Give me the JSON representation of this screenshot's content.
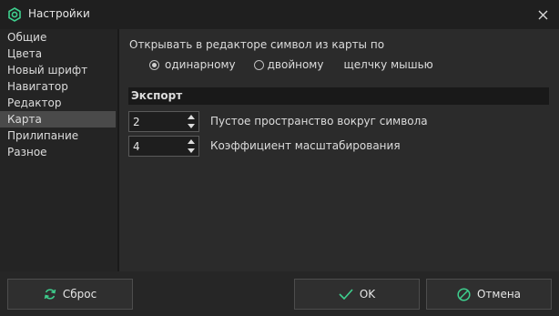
{
  "window": {
    "title": "Настройки",
    "accent": "#3ecf8e"
  },
  "sidebar": {
    "items": [
      {
        "label": "Общие"
      },
      {
        "label": "Цвета"
      },
      {
        "label": "Новый шрифт"
      },
      {
        "label": "Навигатор"
      },
      {
        "label": "Редактор"
      },
      {
        "label": "Карта",
        "selected": true
      },
      {
        "label": "Прилипание"
      },
      {
        "label": "Разное"
      }
    ]
  },
  "main": {
    "open_label": "Открывать в редакторе символ из карты по",
    "radio_single": "одинарному",
    "radio_double": "двойному",
    "click_suffix": "щелчку мышью",
    "selected_option": "одинарному",
    "export_header": "Экспорт",
    "spin_padding_value": "2",
    "spin_padding_label": "Пустое пространство вокруг символа",
    "spin_scale_value": "4",
    "spin_scale_label": "Коэффициент масштабирования"
  },
  "footer": {
    "reset": "Сброс",
    "ok": "OK",
    "cancel": "Отмена"
  }
}
